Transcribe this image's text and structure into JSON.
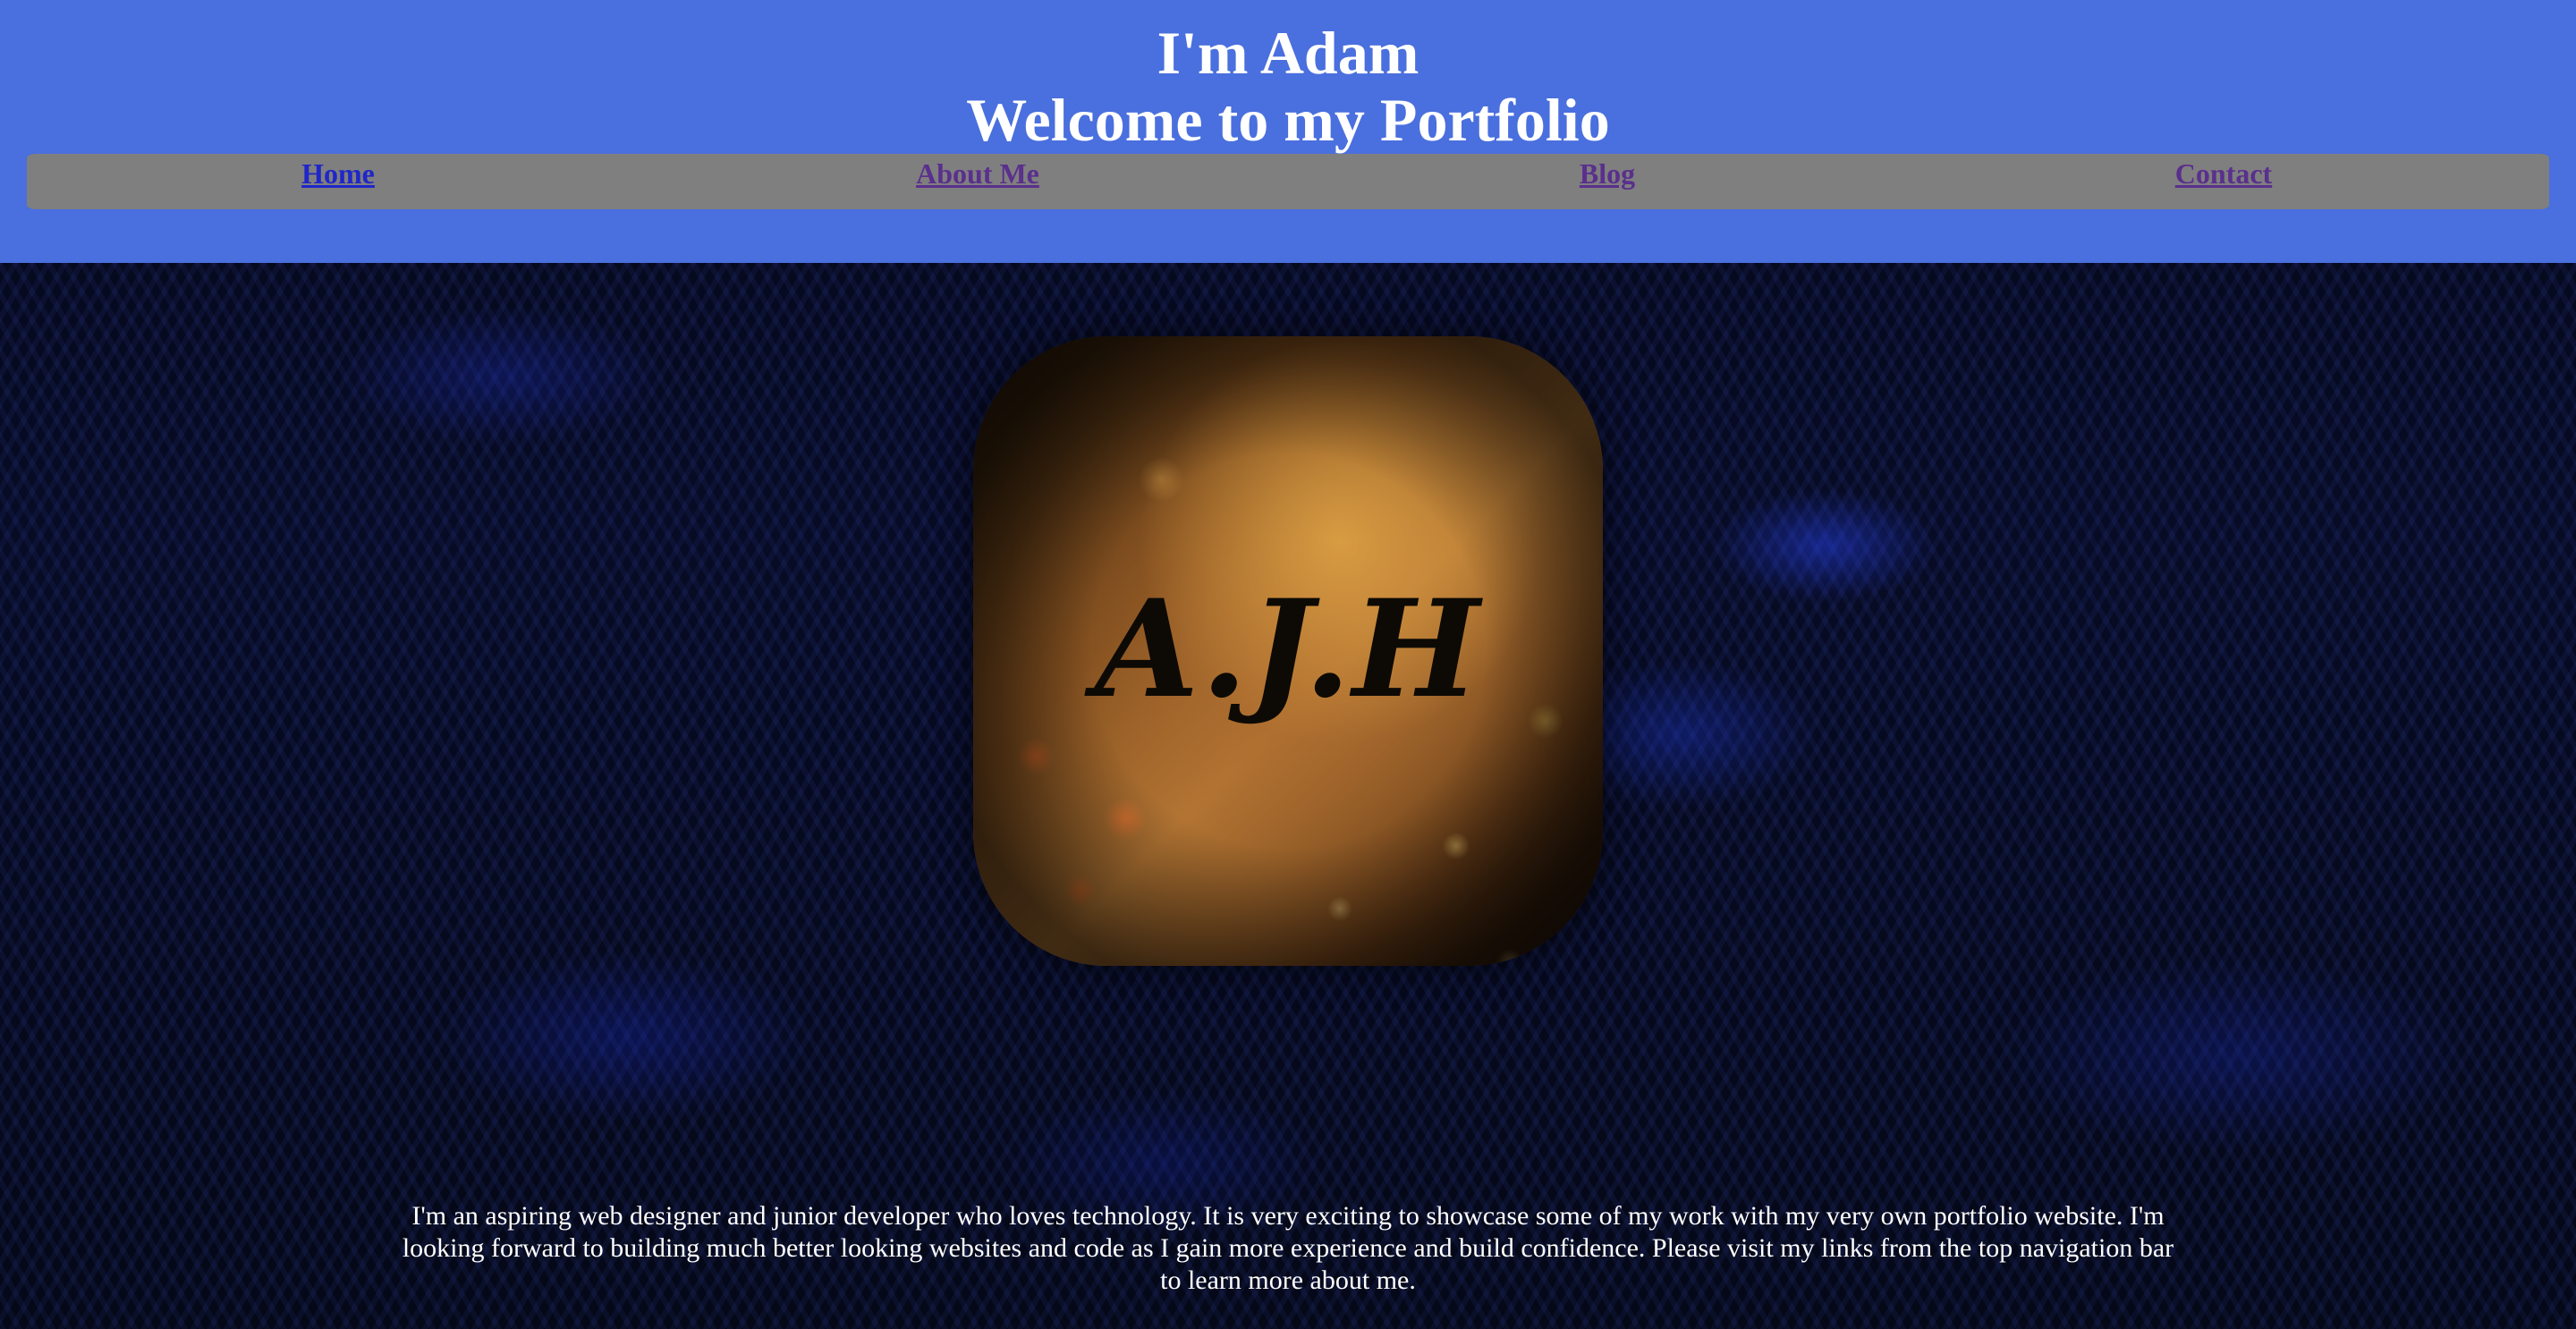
{
  "header": {
    "title_line1": "I'm Adam",
    "title_line2": "Welcome to my Portfolio",
    "background_color": "#4a6fde"
  },
  "nav": {
    "background_color": "#7f7f7f",
    "items": [
      {
        "label": "Home",
        "state": "unvisited",
        "color": "#1f26c9"
      },
      {
        "label": "About Me",
        "state": "visited",
        "color": "#5a2f8d"
      },
      {
        "label": "Blog",
        "state": "visited",
        "color": "#5a2f8d"
      },
      {
        "label": "Contact",
        "state": "visited",
        "color": "#5a2f8d"
      }
    ]
  },
  "logo": {
    "text": "A.J.H",
    "icon": "monogram-logo"
  },
  "intro": {
    "text": "I'm an aspiring web designer and junior developer who loves technology. It is very exciting to showcase some of my work with my very own portfolio website. I'm looking forward to building much better looking websites and code as I gain more experience and build confidence. Please visit my links from the top navigation bar to learn more about me."
  }
}
